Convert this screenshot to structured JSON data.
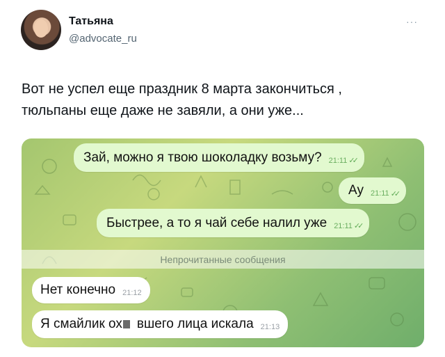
{
  "tweet": {
    "author_name": "Татьяна",
    "author_handle": "@advocate_ru",
    "more_glyph": "···",
    "text_lines": [
      "Вот не успел еще праздник 8 марта закончиться ,",
      "тюльпаны еще даже не завяли, а они уже..."
    ]
  },
  "chat": {
    "messages": [
      {
        "text": "Зай, можно я твою шоколадку возьму?",
        "time": "21:11",
        "direction": "out",
        "read": true
      },
      {
        "text": "Ау",
        "time": "21:11",
        "direction": "out",
        "read": true
      },
      {
        "text": "Быстрее, а то я чай себе налил уже",
        "time": "21:11",
        "direction": "out",
        "read": true
      }
    ],
    "unread_divider": "Непрочитанные сообщения",
    "replies": [
      {
        "text": "Нет конечно",
        "time": "21:12",
        "direction": "in"
      },
      {
        "text_before": "Я смайлик ох",
        "text_after": "вшего лица искала",
        "time": "21:13",
        "direction": "in"
      }
    ],
    "read_check_glyph": "✓✓",
    "colors": {
      "outgoing_bubble": "#e2f9cf",
      "incoming_bubble": "#ffffff",
      "wallpaper": "#a4c66f"
    }
  }
}
